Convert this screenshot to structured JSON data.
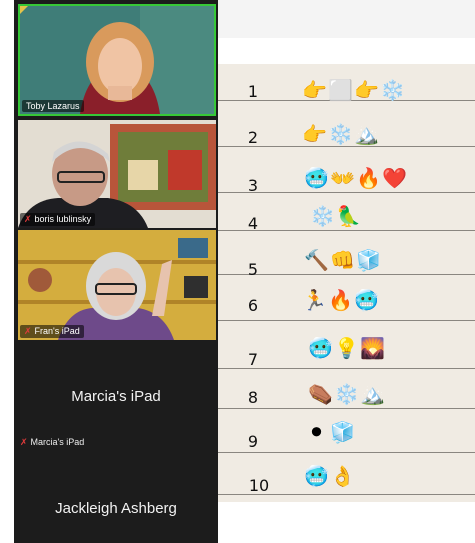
{
  "participants": {
    "tile1": {
      "name": "Toby Lazarus",
      "muted": false
    },
    "tile2": {
      "name": "boris lublinsky",
      "muted": true
    },
    "tile3": {
      "name": "Fran's iPad",
      "muted": true
    },
    "tile4": {
      "display_name": "Marcia's iPad",
      "tag": "Marcia's iPad",
      "muted": true
    },
    "tile5": {
      "display_name": "Jackleigh Ashberg"
    }
  },
  "puzzle": {
    "rows": [
      {
        "num": "1",
        "emojis": [
          "👉",
          "⬜",
          "👉",
          "❄️"
        ]
      },
      {
        "num": "2",
        "emojis": [
          "👉",
          "❄️",
          "🏔️"
        ]
      },
      {
        "num": "3",
        "emojis": [
          "🥶",
          "👐",
          "🔥",
          "❤️"
        ]
      },
      {
        "num": "4",
        "emojis": [
          "❄️",
          "🦜"
        ]
      },
      {
        "num": "5",
        "emojis": [
          "🔨",
          "👊",
          "🧊"
        ]
      },
      {
        "num": "6",
        "emojis": [
          "🏃",
          "🔥",
          "🥶"
        ]
      },
      {
        "num": "7",
        "emojis": [
          "🥶",
          "💡",
          "🌄"
        ]
      },
      {
        "num": "8",
        "emojis": [
          "⚰️",
          "❄️",
          "🏔️"
        ]
      },
      {
        "num": "9",
        "emojis": [
          "⚫",
          "🧊"
        ]
      },
      {
        "num": "10",
        "emojis": [
          "🥶",
          "👌"
        ]
      }
    ]
  },
  "colors": {
    "speaker_border": "#37c837",
    "mic_off": "#e03b3b",
    "sheet_bg": "#f0ebe3"
  }
}
